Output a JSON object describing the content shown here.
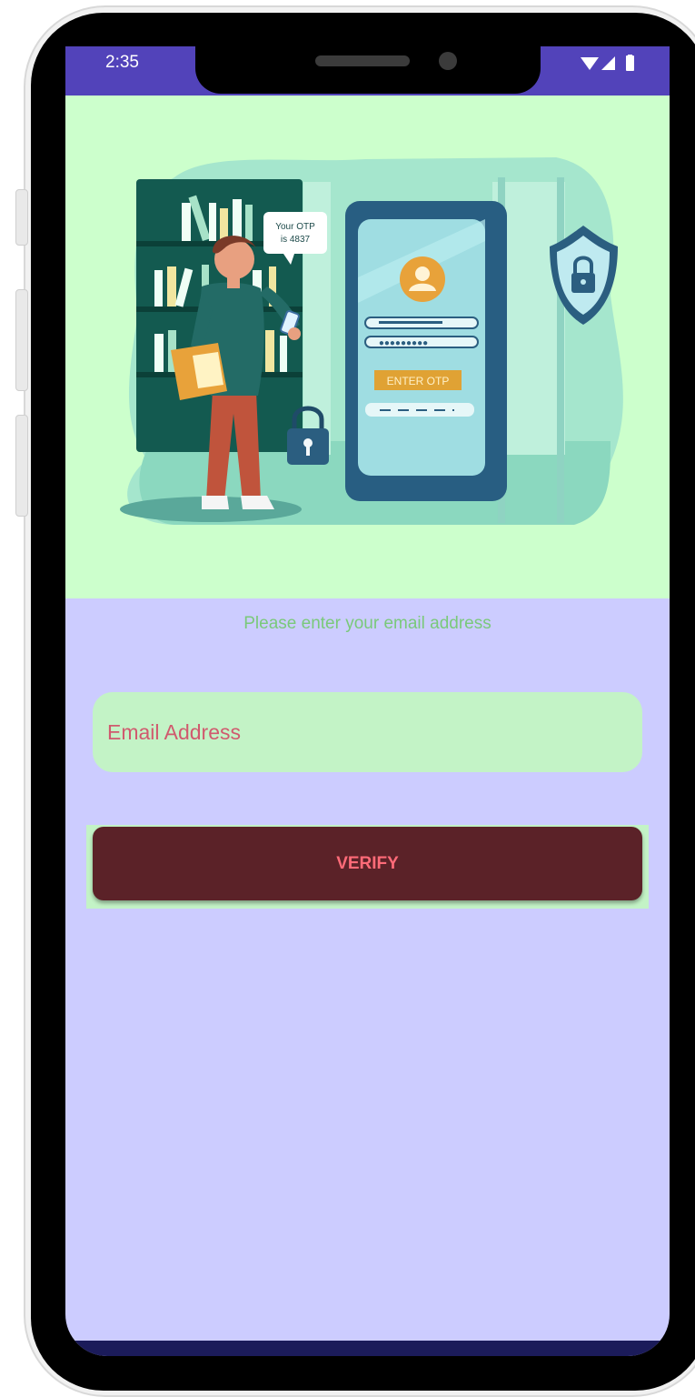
{
  "status_bar": {
    "time": "2:35",
    "icons": [
      "wifi-icon",
      "signal-icon",
      "battery-icon"
    ],
    "color": "#5243ba"
  },
  "hero": {
    "speech_bubble": [
      "Your OTP",
      "is 4837"
    ],
    "otp_button_label": "ENTER OTP",
    "background": "#ccffcc"
  },
  "form": {
    "prompt": "Please enter your email address",
    "email_placeholder": "Email Address",
    "email_value": "",
    "verify_label": "VERIFY"
  },
  "colors": {
    "screen_background": "#ccccff",
    "field_background": "#c3f3c6",
    "button_background": "#5b2228",
    "button_text": "#ff6b78",
    "placeholder_text": "#d05a6e",
    "prompt_text": "#7ac97a"
  }
}
